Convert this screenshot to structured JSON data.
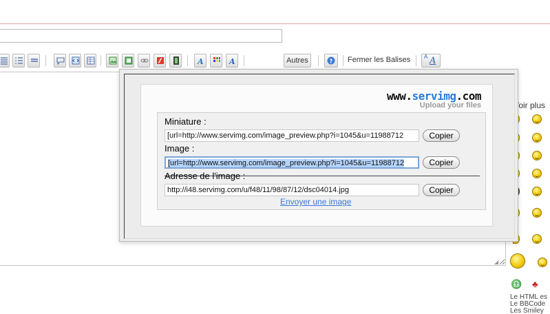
{
  "toolbar": {
    "autres_label": "Autres",
    "close_tags_label": "Fermer les Balises",
    "font_label": "A",
    "font_sub": "A"
  },
  "smilies": {
    "voir_plus": "Voir plus",
    "note_lines": [
      "Le HTML es",
      "Le BBCode",
      "Les Smiley"
    ]
  },
  "popup": {
    "logo": {
      "prefix": "www.",
      "brand": "servimg",
      "suffix": ".com",
      "tagline": "Upload your files"
    },
    "fields": [
      {
        "label": "Miniature :",
        "value": "[url=http://www.servimg.com/image_preview.php?i=1045&u=11988712",
        "button": "Copier",
        "selected": false
      },
      {
        "label": "Image :",
        "value": "[url=http://www.servimg.com/image_preview.php?i=1045&u=11988712",
        "button": "Copier",
        "selected": true
      },
      {
        "label": "Adresse de l'image :",
        "value": "http://i48.servimg.com/u/f48/11/98/87/12/dsc04014.jpg",
        "button": "Copier",
        "selected": false
      }
    ],
    "upload_link": "Envoyer une image"
  },
  "colors": {
    "link": "#3a76d8",
    "brand_blue": "#2a7bd8",
    "selection": "#b5d4fb"
  }
}
